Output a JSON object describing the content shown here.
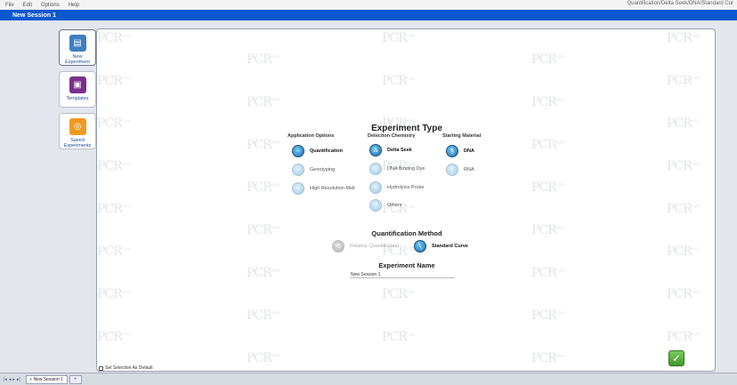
{
  "menu": [
    "File",
    "Edit",
    "Options",
    "Help"
  ],
  "breadcrumb": "Quantification/Delta Seek/DNA/Standard Cur",
  "session_title": "New Session 1",
  "nav": [
    {
      "label": "New\nExperiment",
      "icon": "new-experiment-icon",
      "color": "#3f7fc1"
    },
    {
      "label": "Templates",
      "icon": "templates-icon",
      "color": "#7a2f8c"
    },
    {
      "label": "Saved\nExperiments",
      "icon": "saved-experiments-icon",
      "color": "#f09a1f"
    }
  ],
  "watermark": {
    "text": "PCR",
    "sup": "max"
  },
  "experiment_type_title": "Experiment Type",
  "columns": {
    "application": {
      "header": "Application Options",
      "options": [
        {
          "label": "Quantification",
          "state": "selected"
        },
        {
          "label": "Genotyping",
          "state": "available"
        },
        {
          "label": "High Resolution Melt",
          "state": "available"
        }
      ]
    },
    "detection": {
      "header": "Detection Chemistry",
      "options": [
        {
          "label": "Delta Seek",
          "state": "selected"
        },
        {
          "label": "DNA Binding Dye",
          "state": "available"
        },
        {
          "label": "Hydrolysis Probe",
          "state": "available"
        },
        {
          "label": "Others",
          "state": "available"
        }
      ]
    },
    "starting": {
      "header": "Starting Material",
      "options": [
        {
          "label": "DNA",
          "state": "selected"
        },
        {
          "label": "RNA",
          "state": "available"
        }
      ]
    }
  },
  "quantification_method": {
    "title": "Quantification Method",
    "options": [
      {
        "label": "Relative Quantification",
        "state": "disabled"
      },
      {
        "label": "Standard Curve",
        "state": "selected"
      }
    ]
  },
  "experiment_name": {
    "title": "Experiment Name",
    "value": "New Session 1"
  },
  "set_default_label": "Set Selection As Default",
  "tabs": [
    {
      "label": "New Session 1"
    }
  ]
}
